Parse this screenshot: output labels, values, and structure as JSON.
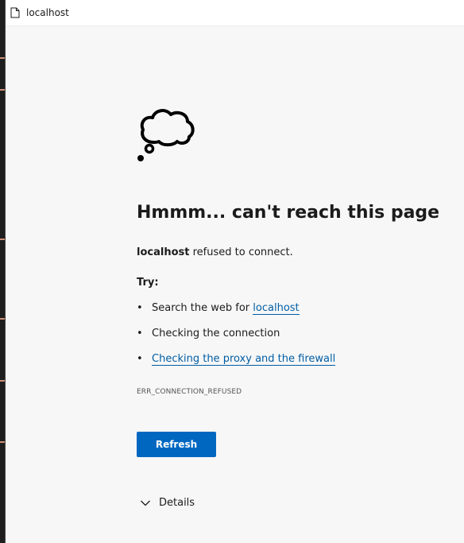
{
  "window": {
    "tab_title": "localhost"
  },
  "icons": {
    "page": "page-icon",
    "cloud": "thought-cloud-icon",
    "chevron": "chevron-down-icon"
  },
  "error_page": {
    "heading": "Hmmm... can't reach this page",
    "host": "localhost",
    "lead_suffix": " refused to connect.",
    "try_label": "Try:",
    "suggestions": [
      {
        "prefix": "Search the web for ",
        "link": "localhost"
      },
      {
        "text": "Checking the connection"
      },
      {
        "link": "Checking the proxy and the firewall"
      }
    ],
    "error_code": "ERR_CONNECTION_REFUSED",
    "refresh_label": "Refresh",
    "details_label": "Details"
  },
  "colors": {
    "accent": "#0067c0",
    "link": "#005ea6",
    "page_bg": "#f7f7f7",
    "text": "#1b1b1b"
  }
}
